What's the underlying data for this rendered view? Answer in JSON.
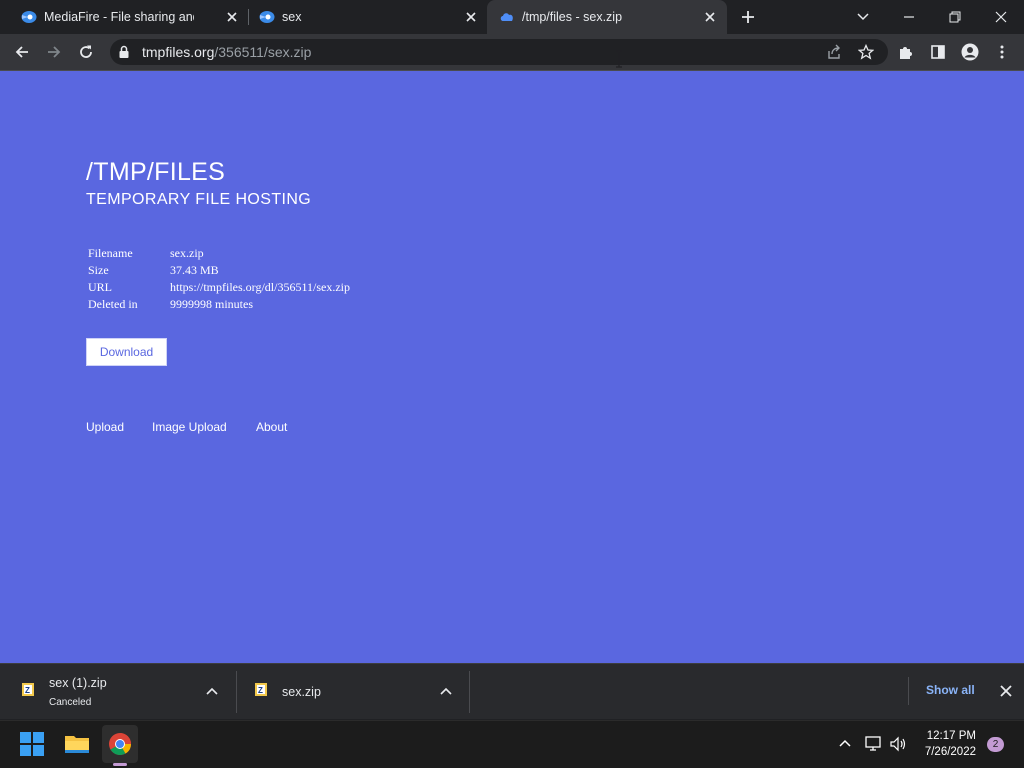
{
  "browser": {
    "tabs": [
      {
        "title": "MediaFire - File sharing and stora",
        "icon": "mediafire-icon"
      },
      {
        "title": "sex",
        "icon": "mediafire-icon"
      },
      {
        "title": "/tmp/files - sex.zip",
        "icon": "cloud-icon",
        "active": true
      }
    ],
    "url_host": "tmpfiles.org",
    "url_path": "/356511/sex.zip"
  },
  "page": {
    "title": "/TMP/FILES",
    "subtitle": "TEMPORARY FILE HOSTING",
    "info": [
      {
        "label": "Filename",
        "value": "sex.zip"
      },
      {
        "label": "Size",
        "value": "37.43 MB"
      },
      {
        "label": "URL",
        "value": "https://tmpfiles.org/dl/356511/sex.zip"
      },
      {
        "label": "Deleted in",
        "value": "9999998 minutes"
      }
    ],
    "download_label": "Download",
    "footer_links": [
      "Upload",
      "Image Upload",
      "About"
    ],
    "background_color": "#5a67e0"
  },
  "downloads": {
    "items": [
      {
        "name": "sex (1).zip",
        "status": "Canceled",
        "icon": "zip-file-icon"
      },
      {
        "name": "sex.zip",
        "status": "",
        "icon": "zip-file-icon"
      }
    ],
    "show_all_label": "Show all"
  },
  "taskbar": {
    "time": "12:17 PM",
    "date": "7/26/2022",
    "notification_count": "2"
  }
}
